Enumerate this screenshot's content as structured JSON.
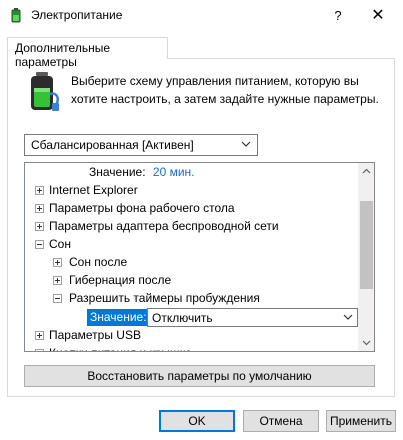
{
  "window": {
    "title": "Электропитание"
  },
  "titlebar": {
    "help_label": "?",
    "close_label": "✕"
  },
  "tab": {
    "label": "Дополнительные параметры"
  },
  "description": "Выберите схему управления питанием, которую вы хотите настроить, а затем задайте нужные параметры.",
  "scheme_select": {
    "value": "Сбалансированная [Активен]"
  },
  "tree": {
    "top_value": {
      "label": "Значение:",
      "value": "20 мин."
    },
    "items": [
      {
        "label": "Internet Explorer",
        "expander": "plus"
      },
      {
        "label": "Параметры фона рабочего стола",
        "expander": "plus"
      },
      {
        "label": "Параметры адаптера беспроводной сети",
        "expander": "plus"
      },
      {
        "label": "Сон",
        "expander": "minus"
      },
      {
        "label": "Сон после",
        "expander": "plus"
      },
      {
        "label": "Гибернация после",
        "expander": "plus"
      },
      {
        "label": "Разрешить таймеры пробуждения",
        "expander": "minus"
      },
      {
        "label": "Параметры USB",
        "expander": "plus"
      },
      {
        "label": "Кнопки питания и крышка",
        "expander": "plus"
      }
    ],
    "selected_setting": {
      "label": "Значение:",
      "value": "Отключить"
    }
  },
  "buttons": {
    "restore": "Восстановить параметры по умолчанию",
    "ok": "OK",
    "cancel": "Отмена",
    "apply": "Применить"
  },
  "colors": {
    "accent": "#0078d7",
    "link": "#1a6bc6"
  }
}
